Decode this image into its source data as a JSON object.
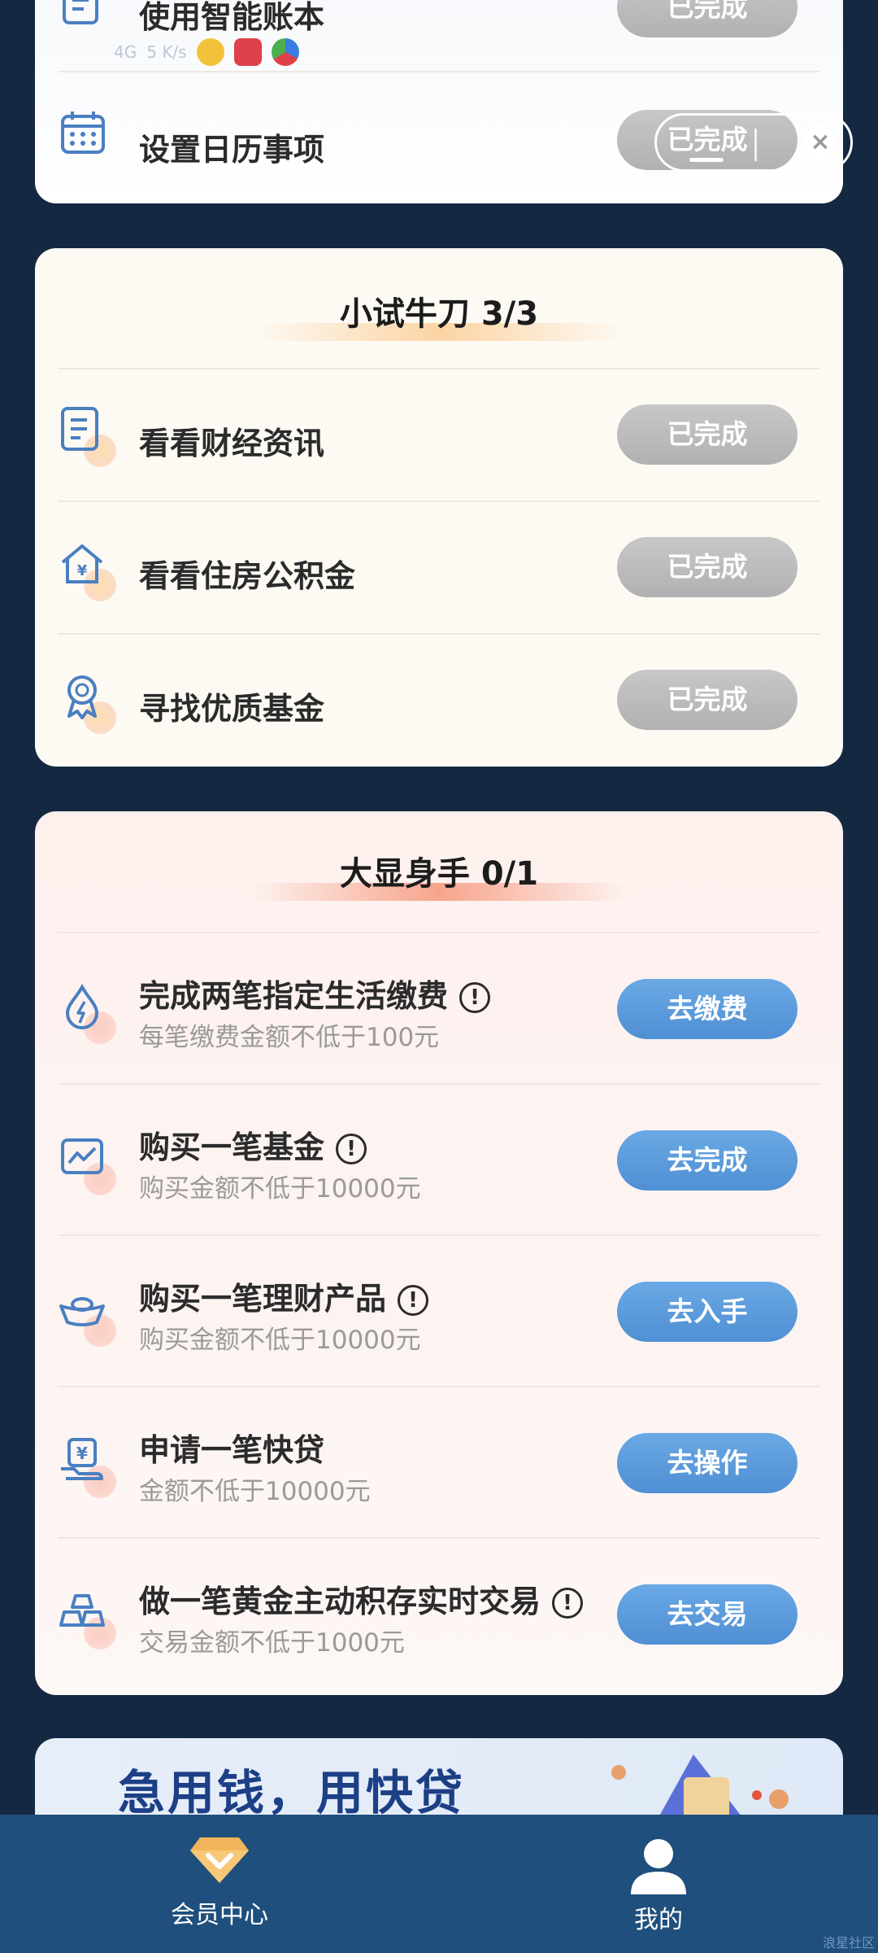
{
  "status_bar": {
    "signal_text": "4G",
    "speed_text": "5 K/s"
  },
  "mini_program_controls": {
    "close_label": "×"
  },
  "section_top": {
    "items": [
      {
        "label": "使用智能账本",
        "button": "已完成",
        "icon": "ledger-icon"
      },
      {
        "label": "设置日历事项",
        "button": "已完成",
        "icon": "calendar-icon"
      }
    ]
  },
  "section_b": {
    "title": "小试牛刀 3/3",
    "items": [
      {
        "label": "看看财经资讯",
        "button": "已完成",
        "icon": "news-icon"
      },
      {
        "label": "看看住房公积金",
        "button": "已完成",
        "icon": "house-fund-icon"
      },
      {
        "label": "寻找优质基金",
        "button": "已完成",
        "icon": "award-ribbon-icon"
      }
    ]
  },
  "section_c": {
    "title": "大显身手 0/1",
    "info_mark": "!",
    "items": [
      {
        "label": "完成两笔指定生活缴费",
        "sub": "每笔缴费金额不低于100元",
        "button": "去缴费",
        "icon": "water-drop-icon",
        "info": true
      },
      {
        "label": "购买一笔基金",
        "sub": "购买金额不低于10000元",
        "button": "去完成",
        "icon": "chart-icon",
        "info": true
      },
      {
        "label": "购买一笔理财产品",
        "sub": "购买金额不低于10000元",
        "button": "去入手",
        "icon": "ingot-icon",
        "info": true
      },
      {
        "label": "申请一笔快贷",
        "sub": "金额不低于10000元",
        "button": "去操作",
        "icon": "loan-hand-icon",
        "info": false
      },
      {
        "label": "做一笔黄金主动积存实时交易",
        "sub": "交易金额不低于1000元",
        "button": "去交易",
        "icon": "gold-bars-icon",
        "info": true
      }
    ]
  },
  "banner": {
    "text": "急用钱，用快贷"
  },
  "tabbar": {
    "tabs": [
      {
        "label": "会员中心",
        "icon": "diamond-icon",
        "active": true
      },
      {
        "label": "我的",
        "icon": "user-icon",
        "active": false
      }
    ]
  },
  "watermark": "浪星社区",
  "colors": {
    "background": "#142842",
    "tabbar": "#1f4f7c",
    "done_button": "#bdbdbd",
    "action_button": "#5b9bdc",
    "icon_blue": "#4a7fc1"
  }
}
